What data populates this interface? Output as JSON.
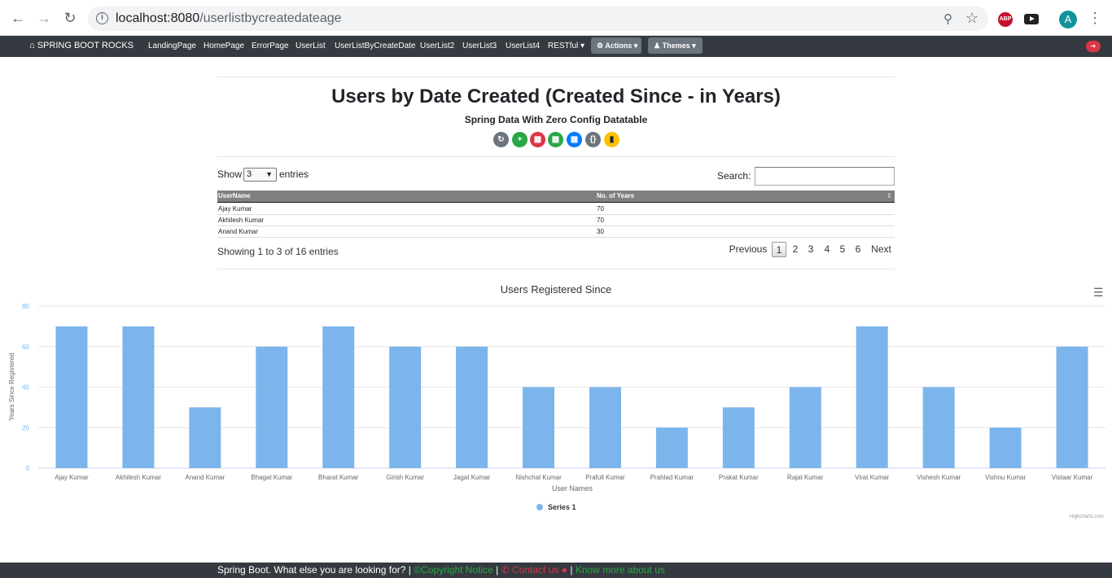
{
  "browser": {
    "url_host": "localhost:8080",
    "url_path": "/userlistbycreatedateage"
  },
  "navbar": {
    "brand": "SPRING BOOT ROCKS",
    "links": [
      "LandingPage",
      "HomePage",
      "ErrorPage",
      "UserList",
      "UserListByCreateDate",
      "UserList2",
      "UserList3",
      "UserList4",
      "RESTful"
    ],
    "actions_label": "Actions",
    "themes_label": "Themes"
  },
  "page": {
    "title": "Users by Date Created (Created Since - in Years)",
    "subtitle": "Spring Data With Zero Config Datatable"
  },
  "toolbar": {
    "buttons": [
      {
        "icon": "refresh-icon",
        "color": "#6c757d"
      },
      {
        "icon": "plus-icon",
        "color": "#28a745"
      },
      {
        "icon": "pdf-icon",
        "color": "#dc3545"
      },
      {
        "icon": "excel-icon",
        "color": "#28a745"
      },
      {
        "icon": "word-icon",
        "color": "#007bff"
      },
      {
        "icon": "json-icon",
        "color": "#6c757d"
      },
      {
        "icon": "file-icon",
        "color": "#ffc107"
      }
    ]
  },
  "table": {
    "show_label": "Show",
    "entries_value": "3",
    "entries_label": "entries",
    "search_label": "Search:",
    "columns": [
      "UserName",
      "No. of Years"
    ],
    "rows": [
      [
        "Ajay Kumar",
        "70"
      ],
      [
        "Akhilesh Kumar",
        "70"
      ],
      [
        "Anand Kumar",
        "30"
      ]
    ],
    "info": "Showing 1 to 3 of 16 entries",
    "pagination": [
      "Previous",
      "1",
      "2",
      "3",
      "4",
      "5",
      "6",
      "Next"
    ],
    "active_page": "1"
  },
  "chart_data": {
    "type": "bar",
    "title": "Users Registered Since",
    "xlabel": "User Names",
    "ylabel": "Years Since Registered",
    "ylim": [
      0,
      80
    ],
    "yticks": [
      0,
      20,
      40,
      60,
      80
    ],
    "categories": [
      "Ajay Kumar",
      "Akhilesh Kumar",
      "Anand Kumar",
      "Bhagat Kumar",
      "Bharat Kumar",
      "Girish Kumar",
      "Jagat Kumar",
      "Nishchal Kumar",
      "Prafull Kumar",
      "Prahlad Kumar",
      "Prakat Kumar",
      "Rajat Kumar",
      "Virat Kumar",
      "Vishesh Kumar",
      "Vishnu Kumar",
      "Vistaar Kumar"
    ],
    "series": [
      {
        "name": "Series 1",
        "color": "#7cb5ec",
        "values": [
          70,
          70,
          30,
          60,
          70,
          60,
          60,
          40,
          40,
          20,
          30,
          40,
          70,
          40,
          20,
          60
        ]
      }
    ],
    "grid": true,
    "legend": "bottom-center",
    "credits": "Highcharts.com"
  },
  "footer": {
    "text": "Spring Boot. What else you are looking for? |",
    "copyright": "©Copyright Notice",
    "sep1": "|",
    "contact": "Contact us",
    "sep2": "|",
    "about": "Know more about us"
  }
}
